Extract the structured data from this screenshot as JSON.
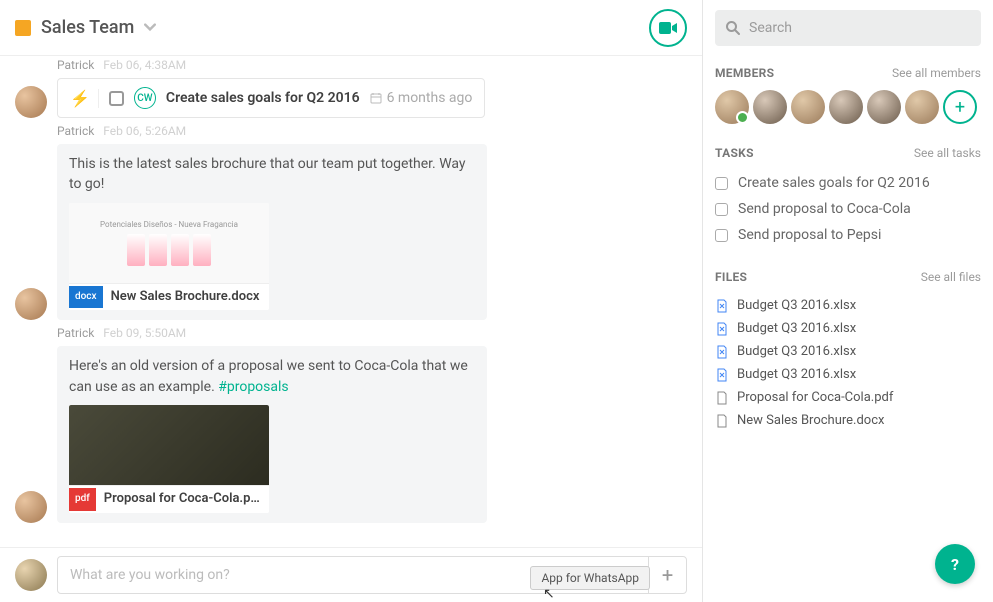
{
  "header": {
    "title": "Sales Team"
  },
  "messages": [
    {
      "author": "Patrick",
      "timestamp": "Feb 06, 4:38AM"
    },
    {
      "task": {
        "badge": "CW",
        "title": "Create sales goals for Q2 2016",
        "age": "6 months ago"
      }
    },
    {
      "author": "Patrick",
      "timestamp": "Feb 06, 5:26AM"
    },
    {
      "text": "This is the latest sales brochure that our team put together. Way to go!",
      "thumb_caption": "Potenciales Diseños - Nueva Fragancia",
      "file_badge": "docx",
      "file_name": "New Sales Brochure.docx"
    },
    {
      "author": "Patrick",
      "timestamp": "Feb 09, 5:50AM"
    },
    {
      "text_pre": "Here's an old version of a proposal we sent to Coca-Cola that we can use as an example. ",
      "hashtag": "#proposals",
      "file_badge": "pdf",
      "file_name": "Proposal for Coca-Cola.p…"
    }
  ],
  "composer": {
    "placeholder": "What are you working on?",
    "tooltip": "App for WhatsApp"
  },
  "search": {
    "placeholder": "Search"
  },
  "sidebar": {
    "members": {
      "title": "MEMBERS",
      "link": "See all members"
    },
    "tasks": {
      "title": "TASKS",
      "link": "See all tasks",
      "items": [
        "Create sales goals for Q2 2016",
        "Send proposal to Coca-Cola",
        "Send proposal to Pepsi"
      ]
    },
    "files": {
      "title": "FILES",
      "link": "See all files",
      "items": [
        {
          "name": "Budget Q3 2016.xlsx",
          "type": "xlsx"
        },
        {
          "name": "Budget Q3 2016.xlsx",
          "type": "xlsx"
        },
        {
          "name": "Budget Q3 2016.xlsx",
          "type": "xlsx"
        },
        {
          "name": "Budget Q3 2016.xlsx",
          "type": "xlsx"
        },
        {
          "name": "Proposal for Coca-Cola.pdf",
          "type": "gen"
        },
        {
          "name": "New Sales Brochure.docx",
          "type": "gen"
        }
      ]
    }
  }
}
